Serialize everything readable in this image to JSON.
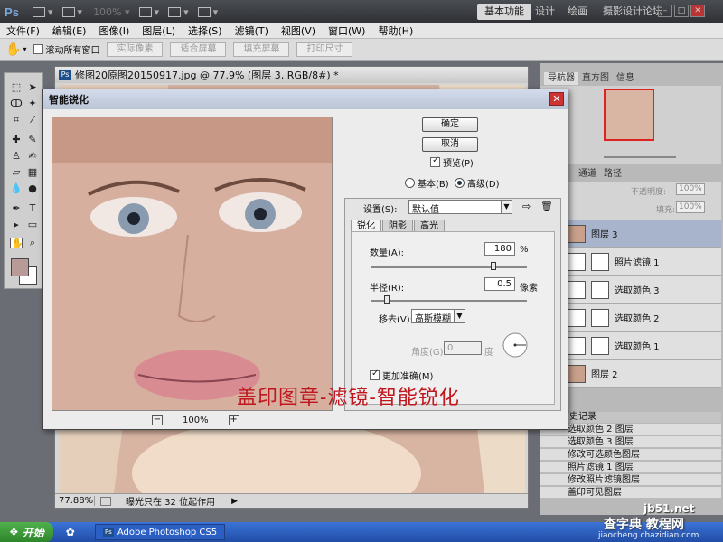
{
  "app": {
    "logo": "Ps",
    "zoom": "100%",
    "workspaces": [
      "基本功能",
      "设计",
      "绘画"
    ],
    "workspace_more": "摄影设计论坛"
  },
  "menu": [
    "文件(F)",
    "编辑(E)",
    "图像(I)",
    "图层(L)",
    "选择(S)",
    "滤镜(T)",
    "视图(V)",
    "窗口(W)",
    "帮助(H)"
  ],
  "options_bar": {
    "scroll_all": "滚动所有窗口",
    "buttons": [
      "实际像素",
      "适合屏幕",
      "填充屏幕",
      "打印尺寸"
    ]
  },
  "document": {
    "title": "修图20原图20150917.jpg @ 77.9% (图层 3, RGB/8#) *",
    "zoom": "77.88%",
    "status": "曝光只在 32 位起作用"
  },
  "dialog": {
    "title": "智能锐化",
    "ok": "确定",
    "cancel": "取消",
    "preview": "预览(P)",
    "mode_basic": "基本(B)",
    "mode_advanced": "高级(D)",
    "settings_label": "设置(S):",
    "settings_value": "默认值",
    "tabs": [
      "锐化",
      "阴影",
      "高光"
    ],
    "amount_label": "数量(A):",
    "amount_value": "180",
    "amount_unit": "%",
    "radius_label": "半径(R):",
    "radius_value": "0.5",
    "radius_unit": "像素",
    "remove_label": "移去(V):",
    "remove_value": "高斯模糊",
    "angle_label": "角度(G):",
    "angle_value": "0",
    "angle_unit": "度",
    "more_accurate": "更加准确(M)",
    "preview_zoom": "100%",
    "overlay": "盖印图章-滤镜-智能锐化"
  },
  "panels": {
    "nav_tabs": [
      "导航器",
      "直方图",
      "信息"
    ],
    "layer_tabs": [
      "通道",
      "路径"
    ],
    "opacity_label": "不透明度:",
    "opacity_value": "100%",
    "fill_label": "填充:",
    "fill_value": "100%",
    "layers": [
      {
        "name": "图层 3",
        "thumb": "photo"
      },
      {
        "name": "照片滤镜 1",
        "thumb": "adj"
      },
      {
        "name": "选取颜色 3",
        "thumb": "adj"
      },
      {
        "name": "选取颜色 2",
        "thumb": "adj"
      },
      {
        "name": "选取颜色 1",
        "thumb": "adj"
      },
      {
        "name": "图层 2",
        "thumb": "photo"
      }
    ],
    "history_title": "历史记录",
    "history": [
      "选取颜色 2 图层",
      "选取颜色 3 图层",
      "修改可选颜色图层",
      "照片滤镜 1 图层",
      "修改照片滤镜图层",
      "盖印可见图层"
    ]
  },
  "taskbar": {
    "start": "开始",
    "task": "Adobe Photoshop CS5"
  },
  "watermark": [
    "jb51.net",
    "查字典 教程网",
    "jiaocheng.chazidian.com"
  ]
}
